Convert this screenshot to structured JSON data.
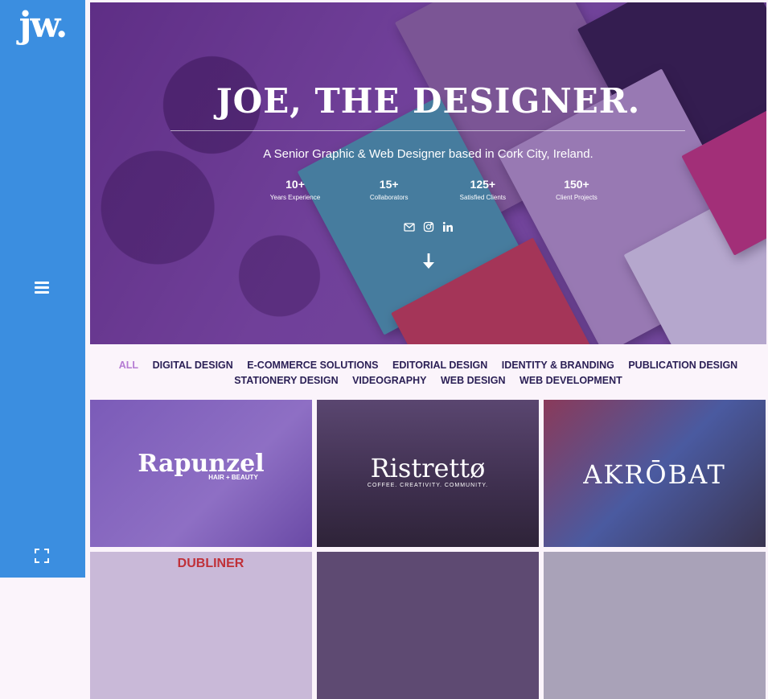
{
  "sidebar": {
    "logo": "jw."
  },
  "hero": {
    "title": "JOE, THE DESIGNER.",
    "subtitle": "A Senior Graphic & Web Designer based in Cork City, Ireland.",
    "stats": [
      {
        "num": "10+",
        "label": "Years Experience"
      },
      {
        "num": "15+",
        "label": "Collaborators"
      },
      {
        "num": "125+",
        "label": "Satisfied Clients"
      },
      {
        "num": "150+",
        "label": "Client Projects"
      }
    ]
  },
  "filters": [
    "ALL",
    "DIGITAL DESIGN",
    "E-COMMERCE SOLUTIONS",
    "EDITORIAL DESIGN",
    "IDENTITY & BRANDING",
    "PUBLICATION DESIGN",
    "STATIONERY DESIGN",
    "VIDEOGRAPHY",
    "WEB DESIGN",
    "WEB DEVELOPMENT"
  ],
  "tiles": [
    {
      "title": "Rapunzel",
      "sub": "HAIR + BEAUTY"
    },
    {
      "title": "Ristrettø",
      "sub": "COFFEE. CREATIVITY. COMMUNITY."
    },
    {
      "title": "AKRŌBAT",
      "sub": ""
    },
    {
      "title": "DUBLINER",
      "sub": ""
    }
  ],
  "colors": {
    "sidebar": "#3b8ee0",
    "accent": "#b57bd3",
    "filter_text": "#2a1f55",
    "hero": "#6a3a8c"
  }
}
